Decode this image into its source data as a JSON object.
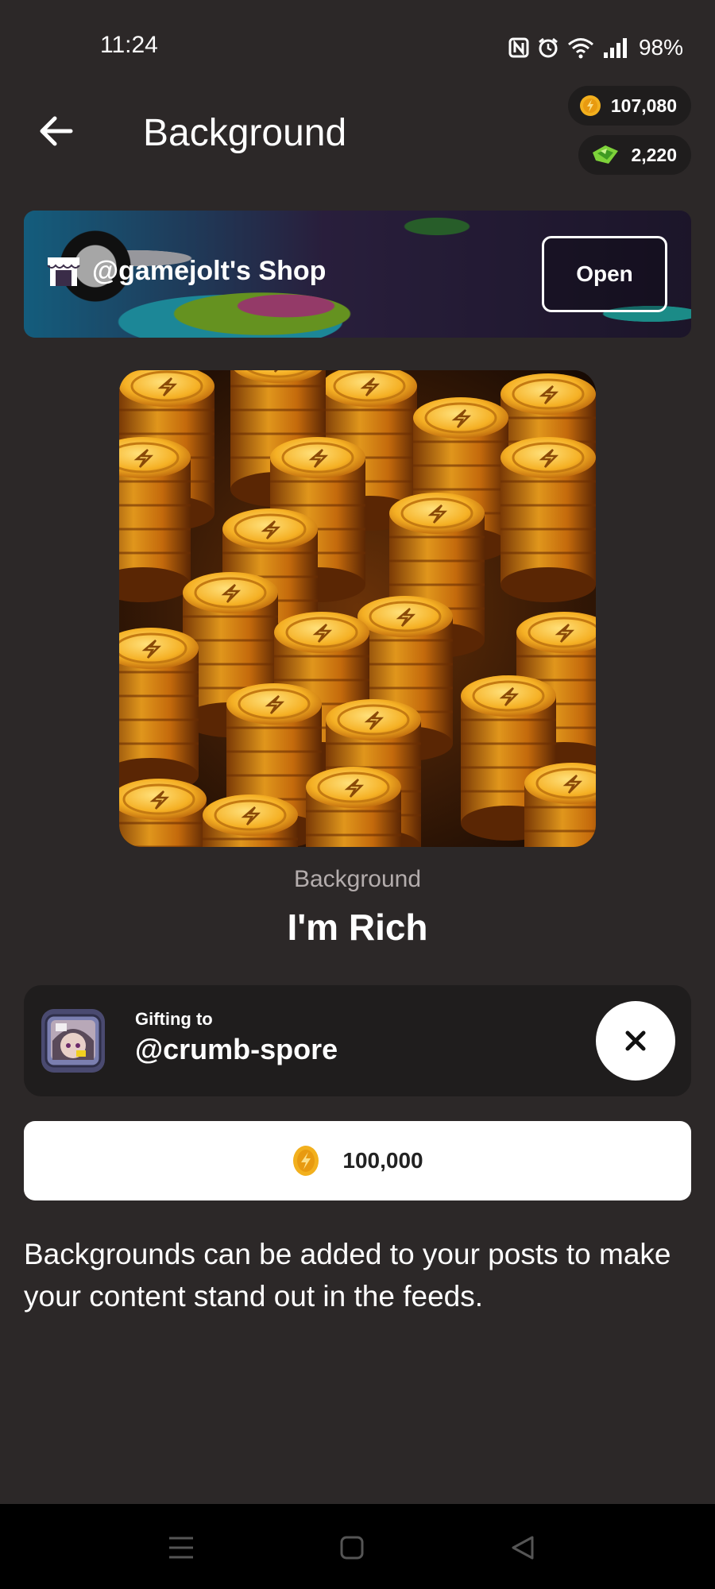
{
  "status_bar": {
    "time": "11:24",
    "battery": "98%",
    "icons": [
      "nfc-icon",
      "alarm-icon",
      "wifi-icon",
      "signal-icon"
    ]
  },
  "header": {
    "title": "Background",
    "back_icon": "back-arrow-icon"
  },
  "wallet": {
    "coins": "107,080",
    "gems": "2,220",
    "coin_icon": "coin-icon",
    "gem_icon": "gem-icon"
  },
  "shop_banner": {
    "label": "@gamejolt's Shop",
    "icon": "shop-icon",
    "button_label": "Open"
  },
  "item": {
    "type_label": "Background",
    "name": "I'm Rich",
    "image": "gold-coin-stacks"
  },
  "gift": {
    "caption": "Gifting to",
    "username": "@crumb-spore",
    "close_icon": "close-icon"
  },
  "purchase": {
    "price": "100,000",
    "icon": "coin-icon"
  },
  "description": "Backgrounds can be added to your posts to make your content stand out in the feeds.",
  "colors": {
    "background": "#2c2828",
    "card": "#1f1d1d",
    "coin_gold": "#f2b01e",
    "gem_green": "#7ed23a"
  }
}
